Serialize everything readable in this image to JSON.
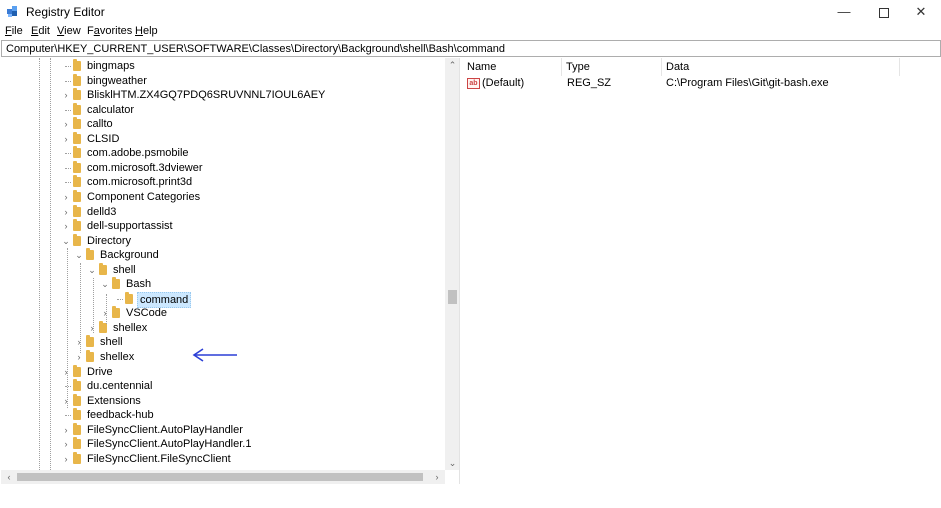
{
  "window": {
    "title": "Registry Editor",
    "minimize_glyph": "—",
    "close_glyph": "✕"
  },
  "menu": [
    {
      "accel": "F",
      "rest": "ile"
    },
    {
      "accel": "E",
      "rest": "dit"
    },
    {
      "accel": "V",
      "rest": "iew"
    },
    {
      "accel": "a",
      "prefix": "F",
      "rest": "vorites"
    },
    {
      "accel": "H",
      "rest": "elp"
    }
  ],
  "address": "Computer\\HKEY_CURRENT_USER\\SOFTWARE\\Classes\\Directory\\Background\\shell\\Bash\\command",
  "tree": [
    {
      "label": "bingmaps",
      "level": 0,
      "expander": "none"
    },
    {
      "label": "bingweather",
      "level": 0,
      "expander": "none"
    },
    {
      "label": "BlisklHTM.ZX4GQ7PDQ6SRUVNNL7IOUL6AEY",
      "level": 0,
      "expander": "collapsed"
    },
    {
      "label": "calculator",
      "level": 0,
      "expander": "none"
    },
    {
      "label": "callto",
      "level": 0,
      "expander": "collapsed"
    },
    {
      "label": "CLSID",
      "level": 0,
      "expander": "collapsed"
    },
    {
      "label": "com.adobe.psmobile",
      "level": 0,
      "expander": "none"
    },
    {
      "label": "com.microsoft.3dviewer",
      "level": 0,
      "expander": "none"
    },
    {
      "label": "com.microsoft.print3d",
      "level": 0,
      "expander": "none"
    },
    {
      "label": "Component Categories",
      "level": 0,
      "expander": "collapsed"
    },
    {
      "label": "delld3",
      "level": 0,
      "expander": "collapsed"
    },
    {
      "label": "dell-supportassist",
      "level": 0,
      "expander": "collapsed"
    },
    {
      "label": "Directory",
      "level": 0,
      "expander": "expanded"
    },
    {
      "label": "Background",
      "level": 1,
      "expander": "expanded"
    },
    {
      "label": "shell",
      "level": 2,
      "expander": "expanded"
    },
    {
      "label": "Bash",
      "level": 3,
      "expander": "expanded"
    },
    {
      "label": "command",
      "level": 4,
      "expander": "none",
      "selected": true
    },
    {
      "label": "VSCode",
      "level": 3,
      "expander": "collapsed"
    },
    {
      "label": "shellex",
      "level": 2,
      "expander": "collapsed"
    },
    {
      "label": "shell",
      "level": 1,
      "expander": "collapsed"
    },
    {
      "label": "shellex",
      "level": 1,
      "expander": "collapsed"
    },
    {
      "label": "Drive",
      "level": 0,
      "expander": "collapsed"
    },
    {
      "label": "du.centennial",
      "level": 0,
      "expander": "none"
    },
    {
      "label": "Extensions",
      "level": 0,
      "expander": "collapsed"
    },
    {
      "label": "feedback-hub",
      "level": 0,
      "expander": "none"
    },
    {
      "label": "FileSyncClient.AutoPlayHandler",
      "level": 0,
      "expander": "collapsed"
    },
    {
      "label": "FileSyncClient.AutoPlayHandler.1",
      "level": 0,
      "expander": "collapsed"
    },
    {
      "label": "FileSyncClient.FileSyncClient",
      "level": 0,
      "expander": "collapsed"
    }
  ],
  "list": {
    "columns": [
      "Name",
      "Type",
      "Data"
    ],
    "rows": [
      {
        "icon": "ab-icon",
        "icon_text": "ab",
        "name": "(Default)",
        "type": "REG_SZ",
        "data": "C:\\Program Files\\Git\\git-bash.exe"
      }
    ]
  },
  "colors": {
    "selection": "#cce8ff",
    "folder": "#e8b64a",
    "arrow": "#2b3fd6"
  }
}
